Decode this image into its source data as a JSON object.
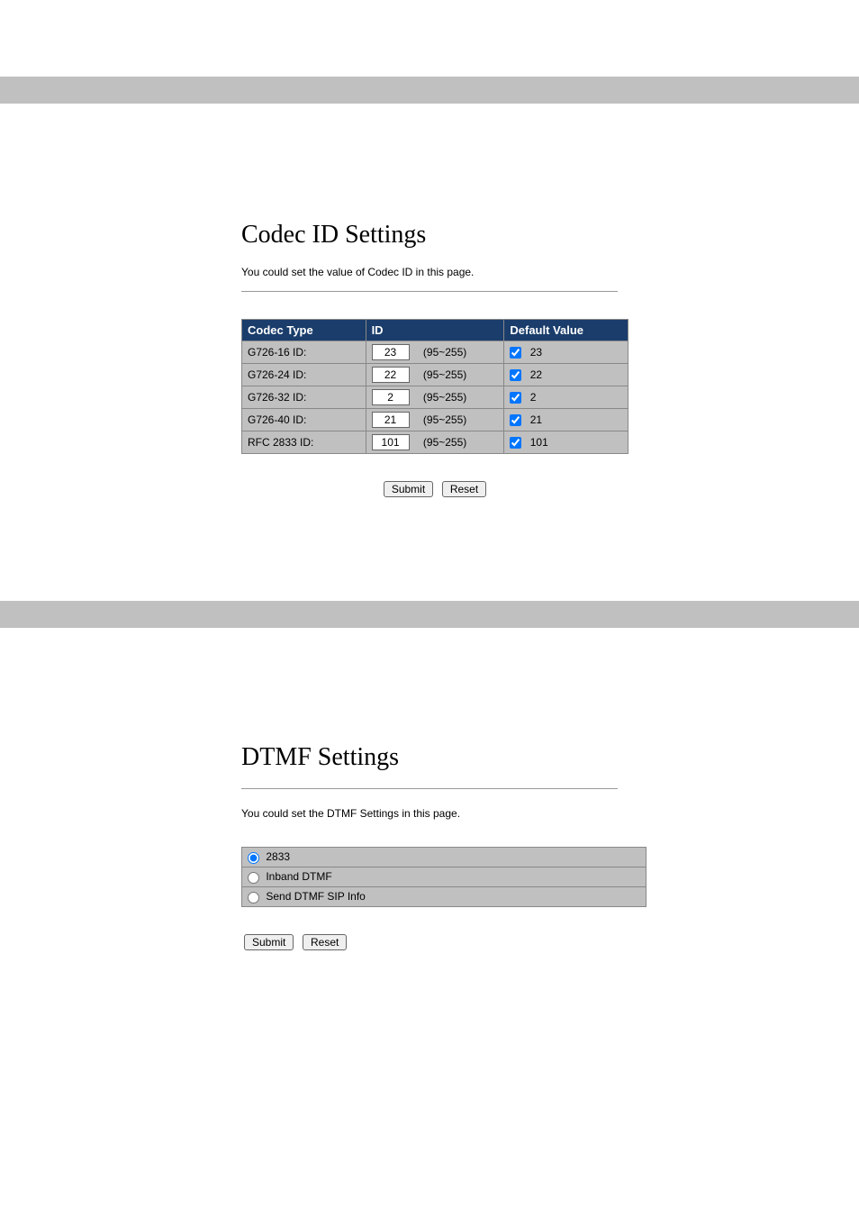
{
  "codec_section": {
    "title": "Codec ID Settings",
    "description": "You could set the value of Codec ID in this page.",
    "headers": {
      "type": "Codec Type",
      "id": "ID",
      "default": "Default Value"
    },
    "rows": [
      {
        "type": "G726-16 ID:",
        "id": "23",
        "range": "(95~255)",
        "checked": true,
        "default_val": "23"
      },
      {
        "type": "G726-24 ID:",
        "id": "22",
        "range": "(95~255)",
        "checked": true,
        "default_val": "22"
      },
      {
        "type": "G726-32 ID:",
        "id": "2",
        "range": "(95~255)",
        "checked": true,
        "default_val": "2"
      },
      {
        "type": "G726-40 ID:",
        "id": "21",
        "range": "(95~255)",
        "checked": true,
        "default_val": "21"
      },
      {
        "type": "RFC 2833 ID:",
        "id": "101",
        "range": "(95~255)",
        "checked": true,
        "default_val": "101"
      }
    ],
    "submit": "Submit",
    "reset": "Reset"
  },
  "dtmf_section": {
    "title": "DTMF Settings",
    "description": "You could set the DTMF Settings in this page.",
    "options": [
      {
        "label": "2833",
        "selected": true
      },
      {
        "label": "Inband DTMF",
        "selected": false
      },
      {
        "label": "Send DTMF SIP Info",
        "selected": false
      }
    ],
    "submit": "Submit",
    "reset": "Reset"
  }
}
